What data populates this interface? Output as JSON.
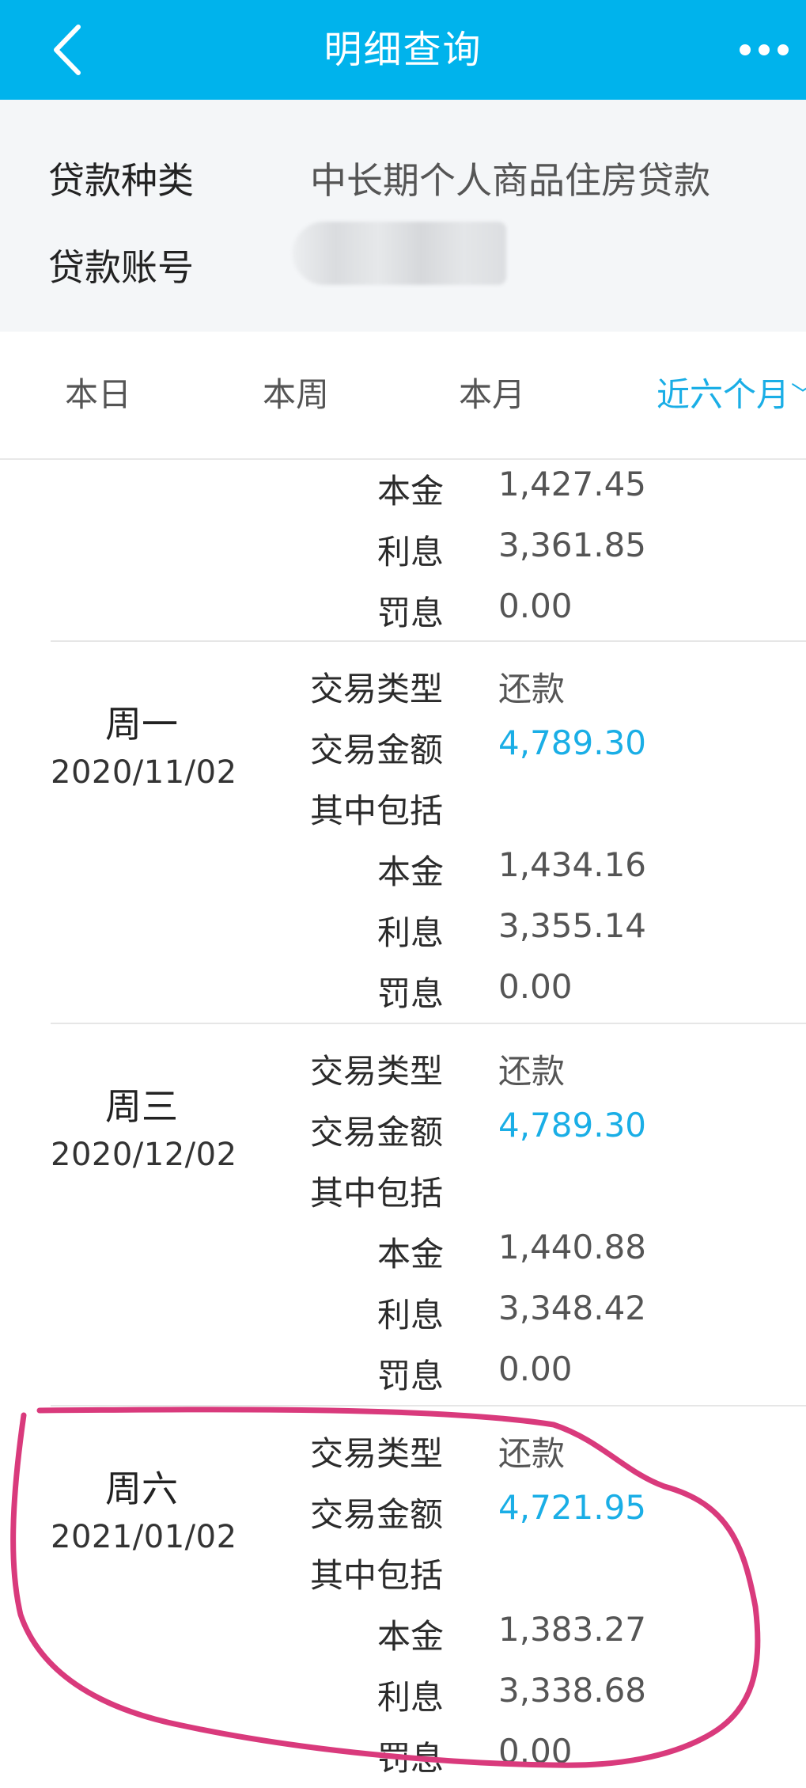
{
  "header": {
    "title": "明细查询",
    "back_icon": "chevron-left-icon",
    "more_icon": "more-dots-icon"
  },
  "loan_info": {
    "type_label": "贷款种类",
    "type_value": "中长期个人商品住房贷款",
    "account_label": "贷款账号"
  },
  "tabs": [
    {
      "label": "本日",
      "active": false
    },
    {
      "label": "本周",
      "active": false
    },
    {
      "label": "本月",
      "active": false
    },
    {
      "label": "近六个月",
      "active": true
    }
  ],
  "labels": {
    "type": "交易类型",
    "amount": "交易金额",
    "includes": "其中包括",
    "principal": "本金",
    "interest": "利息",
    "penalty": "罚息"
  },
  "partial_record": {
    "principal": "1,427.45",
    "interest": "3,361.85",
    "penalty": "0.00"
  },
  "records": [
    {
      "day": "周一",
      "date": "2020/11/02",
      "type": "还款",
      "amount": "4,789.30",
      "principal": "1,434.16",
      "interest": "3,355.14",
      "penalty": "0.00"
    },
    {
      "day": "周三",
      "date": "2020/12/02",
      "type": "还款",
      "amount": "4,789.30",
      "principal": "1,440.88",
      "interest": "3,348.42",
      "penalty": "0.00"
    },
    {
      "day": "周六",
      "date": "2021/01/02",
      "type": "还款",
      "amount": "4,721.95",
      "principal": "1,383.27",
      "interest": "3,338.68",
      "penalty": "0.00"
    }
  ],
  "colors": {
    "header_bg": "#00b3ec",
    "accent": "#1aaee6",
    "annotation": "#d93a7c"
  }
}
